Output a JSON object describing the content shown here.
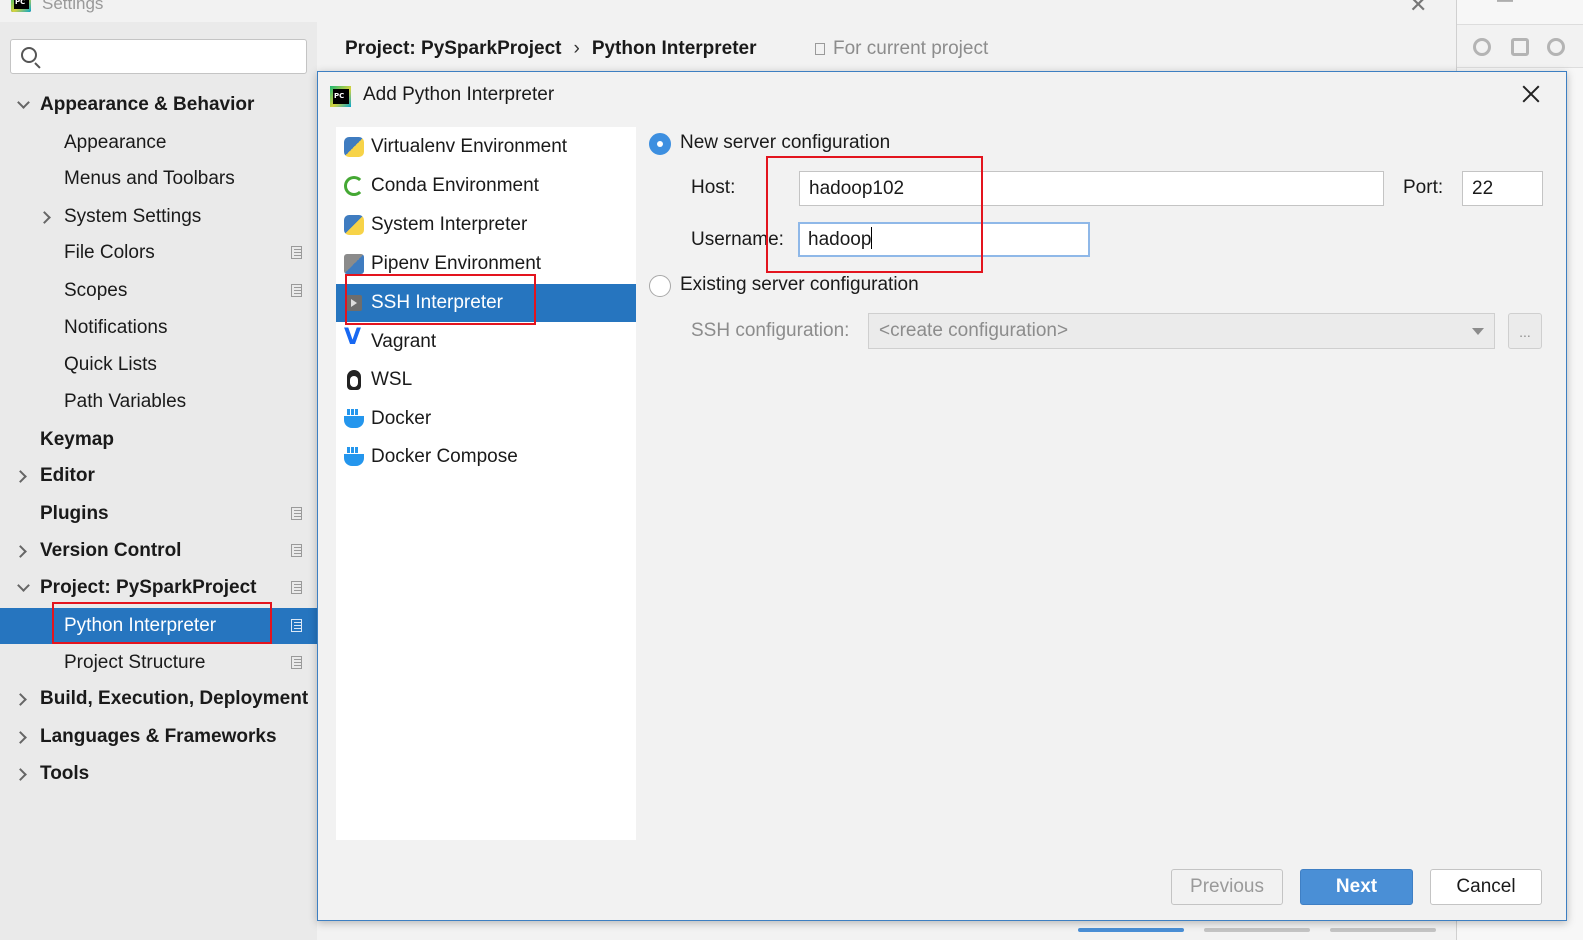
{
  "settings": {
    "title": "Settings",
    "search": {
      "value": "",
      "placeholder": ""
    },
    "tree": [
      {
        "label": "Appearance & Behavior",
        "bold": true
      },
      {
        "label": "Appearance"
      },
      {
        "label": "Menus and Toolbars"
      },
      {
        "label": "System Settings"
      },
      {
        "label": "File Colors"
      },
      {
        "label": "Scopes"
      },
      {
        "label": "Notifications"
      },
      {
        "label": "Quick Lists"
      },
      {
        "label": "Path Variables"
      },
      {
        "label": "Keymap",
        "bold": true
      },
      {
        "label": "Editor",
        "bold": true
      },
      {
        "label": "Plugins",
        "bold": true
      },
      {
        "label": "Version Control",
        "bold": true
      },
      {
        "label": "Project: PySparkProject",
        "bold": true
      },
      {
        "label": "Python Interpreter",
        "selected": true
      },
      {
        "label": "Project Structure"
      },
      {
        "label": "Build, Execution, Deployment",
        "bold": true
      },
      {
        "label": "Languages & Frameworks",
        "bold": true
      },
      {
        "label": "Tools",
        "bold": true
      }
    ],
    "breadcrumb": {
      "parent": "Project: PySparkProject",
      "separator": "›",
      "current": "Python Interpreter"
    },
    "scope_label": "For current project"
  },
  "dialog": {
    "title": "Add Python Interpreter",
    "interpreter_types": [
      {
        "label": "Virtualenv Environment",
        "icon": "python-icon"
      },
      {
        "label": "Conda Environment",
        "icon": "conda-icon"
      },
      {
        "label": "System Interpreter",
        "icon": "python-icon"
      },
      {
        "label": "Pipenv Environment",
        "icon": "pipenv-icon"
      },
      {
        "label": "SSH Interpreter",
        "icon": "ssh-icon",
        "selected": true
      },
      {
        "label": "Vagrant",
        "icon": "vagrant-icon"
      },
      {
        "label": "WSL",
        "icon": "linux-penguin-icon"
      },
      {
        "label": "Docker",
        "icon": "docker-icon"
      },
      {
        "label": "Docker Compose",
        "icon": "docker-icon"
      }
    ],
    "new_config": {
      "label": "New server configuration",
      "selected": true,
      "host_label": "Host:",
      "host_value": "hadoop102",
      "port_label": "Port:",
      "port_value": "22",
      "username_label": "Username:",
      "username_value": "hadoop"
    },
    "existing_config": {
      "label": "Existing server configuration",
      "selected": false,
      "ssh_label": "SSH configuration:",
      "ssh_value": "<create configuration>",
      "browse_label": "..."
    },
    "buttons": {
      "previous": "Previous",
      "next": "Next",
      "cancel": "Cancel"
    }
  },
  "colors": {
    "selection": "#2675bf",
    "accent": "#3d8fe0",
    "highlight_box": "#e3141e"
  }
}
